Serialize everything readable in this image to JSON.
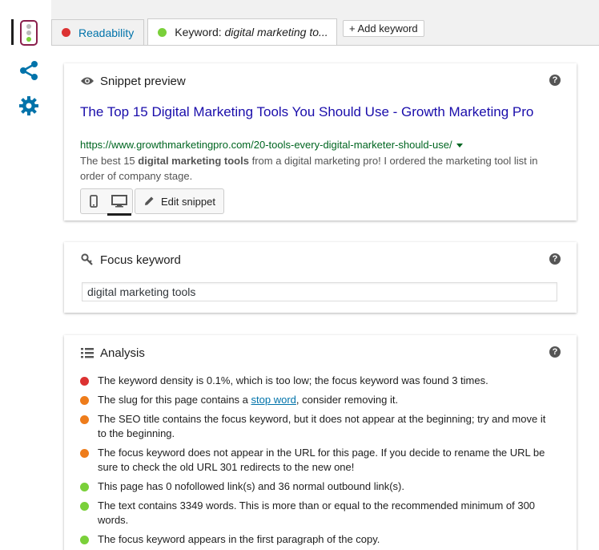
{
  "tabs": {
    "readability": {
      "label": "Readability",
      "status": "red"
    },
    "keyword": {
      "prefix": "Keyword: ",
      "keyword": "digital marketing to...",
      "status": "green"
    },
    "add_keyword": "+ Add keyword"
  },
  "sidebar": {
    "icons": [
      "traffic-light-icon",
      "share-icon",
      "gear-icon"
    ]
  },
  "snippet": {
    "heading": "Snippet preview",
    "title": "The Top 15 Digital Marketing Tools You Should Use - Growth Marketing Pro",
    "url": "https://www.growthmarketingpro.com/20-tools-every-digital-marketer-should-use/",
    "desc_pre": "The best 15 ",
    "desc_bold": "digital marketing tools",
    "desc_post": " from a digital marketing pro! I ordered the marketing tool list in order of company stage.",
    "edit_label": "Edit snippet"
  },
  "focus": {
    "heading": "Focus keyword",
    "value": "digital marketing tools"
  },
  "analysis": {
    "heading": "Analysis",
    "results": [
      {
        "status": "red",
        "text": "The keyword density is 0.1%, which is too low; the focus keyword was found 3 times."
      },
      {
        "status": "orange",
        "pre": "The slug for this page contains a ",
        "link": "stop word",
        "post": ", consider removing it."
      },
      {
        "status": "orange",
        "text": "The SEO title contains the focus keyword, but it does not appear at the beginning; try and move it to the beginning."
      },
      {
        "status": "orange",
        "text": "The focus keyword does not appear in the URL for this page. If you decide to rename the URL be sure to check the old URL 301 redirects to the new one!"
      },
      {
        "status": "green",
        "text": "This page has 0 nofollowed link(s) and 36 normal outbound link(s)."
      },
      {
        "status": "green",
        "text": "The text contains 3349 words. This is more than or equal to the recommended minimum of 300 words."
      },
      {
        "status": "green",
        "text": "The focus keyword appears in the first paragraph of the copy."
      }
    ]
  },
  "colors": {
    "red": "#dc3232",
    "orange": "#ee7c1b",
    "green": "#7ad03a",
    "link": "#1a0dab",
    "url": "#006621"
  }
}
